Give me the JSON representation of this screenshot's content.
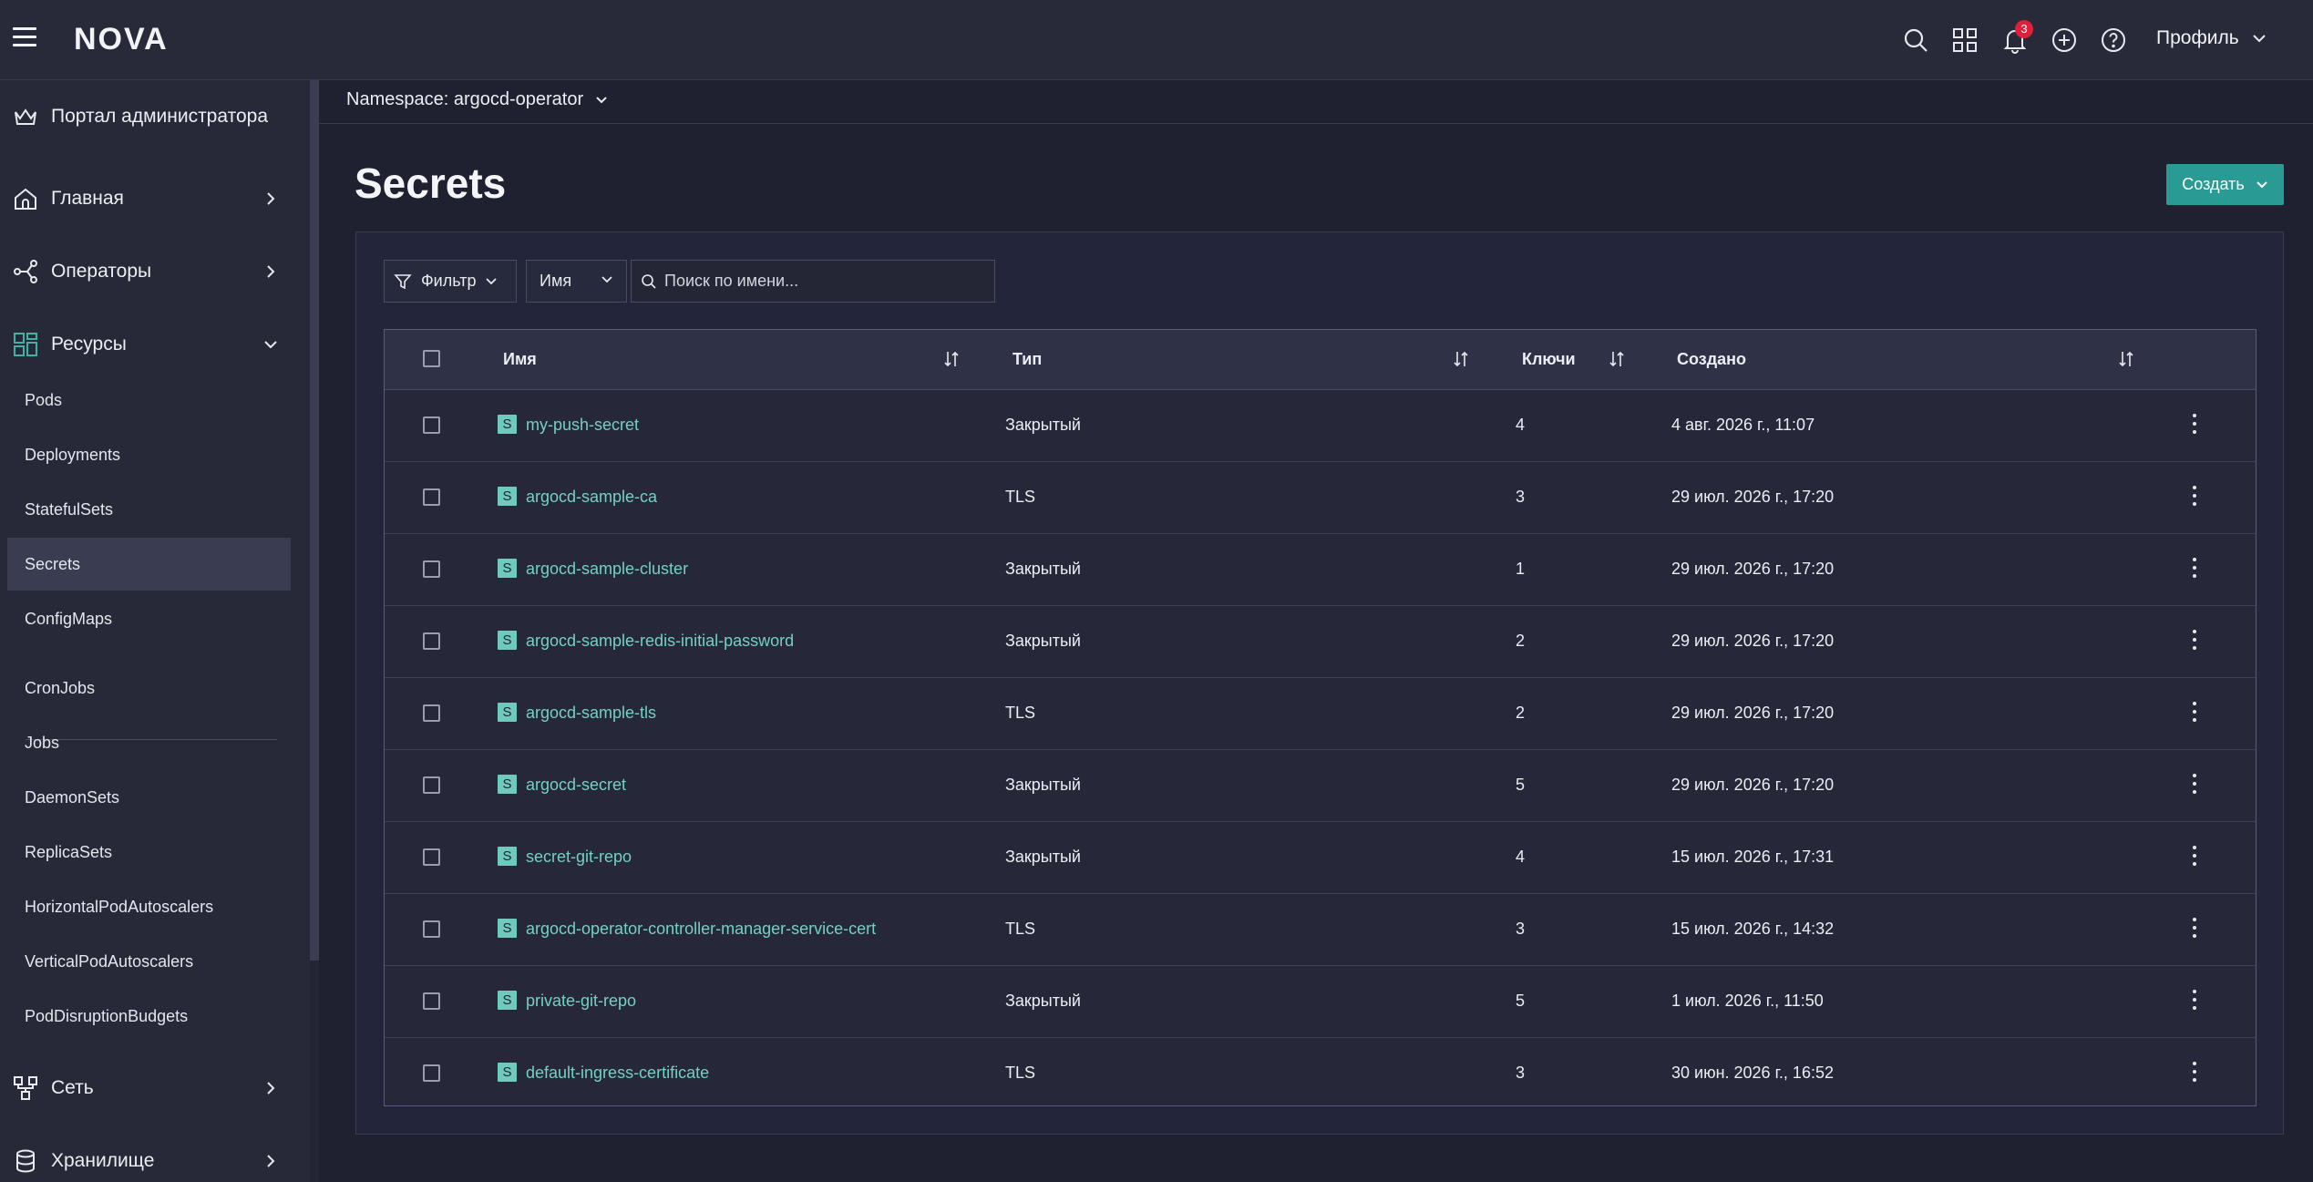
{
  "header": {
    "logo": "NOVA",
    "notifications_count": "3",
    "profile_label": "Профиль"
  },
  "sidebar": {
    "admin_portal": "Портал администратора",
    "sections": [
      {
        "label": "Главная",
        "icon": "home-icon"
      },
      {
        "label": "Операторы",
        "icon": "operators-icon"
      },
      {
        "label": "Ресурсы",
        "icon": "resources-icon"
      }
    ],
    "resource_items": [
      "Pods",
      "Deployments",
      "StatefulSets",
      "Secrets",
      "ConfigMaps"
    ],
    "resource_items_2": [
      "CronJobs",
      "Jobs",
      "DaemonSets",
      "ReplicaSets",
      "HorizontalPodAutoscalers",
      "VerticalPodAutoscalers",
      "PodDisruptionBudgets"
    ],
    "bottom_sections": [
      {
        "label": "Сеть",
        "icon": "network-icon"
      },
      {
        "label": "Хранилище",
        "icon": "storage-icon"
      }
    ],
    "active_item": "Secrets"
  },
  "namespace": {
    "label": "Namespace: argocd-operator"
  },
  "page": {
    "title": "Secrets",
    "create_label": "Создать"
  },
  "toolbar": {
    "filter_label": "Фильтр",
    "column_select": "Имя",
    "search_placeholder": "Поиск по имени..."
  },
  "table": {
    "headers": {
      "name": "Имя",
      "type": "Тип",
      "keys": "Ключи",
      "created": "Создано"
    },
    "badge_letter": "S",
    "rows": [
      {
        "name": "my-push-secret",
        "type": "Закрытый",
        "keys": "4",
        "created": "4 авг. 2026 г., 11:07"
      },
      {
        "name": "argocd-sample-ca",
        "type": "TLS",
        "keys": "3",
        "created": "29 июл. 2026 г., 17:20"
      },
      {
        "name": "argocd-sample-cluster",
        "type": "Закрытый",
        "keys": "1",
        "created": "29 июл. 2026 г., 17:20"
      },
      {
        "name": "argocd-sample-redis-initial-password",
        "type": "Закрытый",
        "keys": "2",
        "created": "29 июл. 2026 г., 17:20"
      },
      {
        "name": "argocd-sample-tls",
        "type": "TLS",
        "keys": "2",
        "created": "29 июл. 2026 г., 17:20"
      },
      {
        "name": "argocd-secret",
        "type": "Закрытый",
        "keys": "5",
        "created": "29 июл. 2026 г., 17:20"
      },
      {
        "name": "secret-git-repo",
        "type": "Закрытый",
        "keys": "4",
        "created": "15 июл. 2026 г., 17:31"
      },
      {
        "name": "argocd-operator-controller-manager-service-cert",
        "type": "TLS",
        "keys": "3",
        "created": "15 июл. 2026 г., 14:32"
      },
      {
        "name": "private-git-repo",
        "type": "Закрытый",
        "keys": "5",
        "created": "1 июл. 2026 г., 11:50"
      },
      {
        "name": "default-ingress-certificate",
        "type": "TLS",
        "keys": "3",
        "created": "30 июн. 2026 г., 16:52"
      }
    ]
  }
}
